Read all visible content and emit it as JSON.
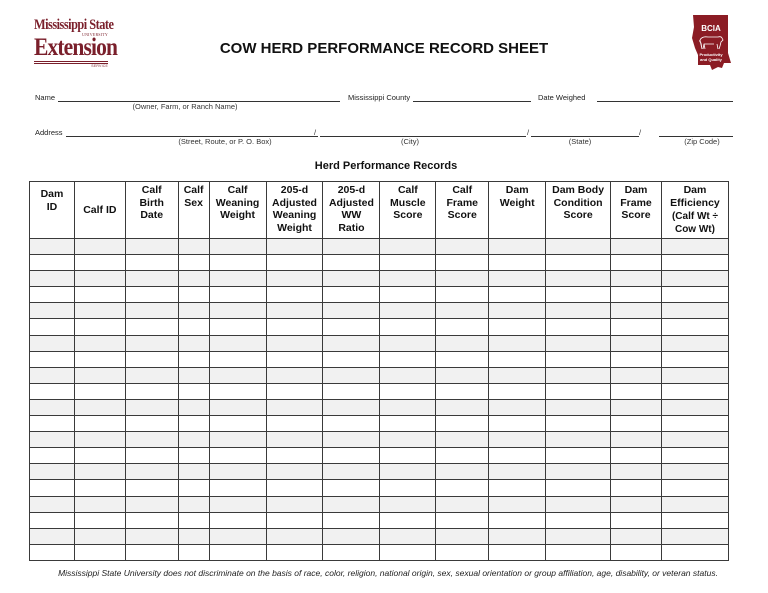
{
  "logos": {
    "left": {
      "line1": "Mississippi State",
      "line2": "UNIVERSITY",
      "line3": "Extension",
      "line4": "SERVICE",
      "brand_color": "#7a1f2b"
    },
    "right": {
      "acronym": "BCIA",
      "tagline1": "Productivity",
      "tagline2": "and Quality",
      "brand_color": "#8b1c24"
    }
  },
  "title": "COW HERD PERFORMANCE RECORD SHEET",
  "form": {
    "name_label": "Name",
    "name_sub": "(Owner, Farm, or Ranch Name)",
    "county_label": "Mississippi County",
    "date_label": "Date Weighed",
    "address_label": "Address",
    "address_subs": [
      "(Street, Route, or P. O. Box)",
      "(City)",
      "(State)",
      "(Zip Code)"
    ],
    "separator": "/"
  },
  "section_title": "Herd Performance Records",
  "table": {
    "columns": [
      [
        "Dam",
        "ID"
      ],
      [
        "Calf ID"
      ],
      [
        "Calf",
        "Birth",
        "Date"
      ],
      [
        "Calf",
        "Sex"
      ],
      [
        "Calf",
        "Weaning",
        "Weight"
      ],
      [
        "205-d",
        "Adjusted",
        "Weaning",
        "Weight"
      ],
      [
        "205-d",
        "Adjusted",
        "WW",
        "Ratio"
      ],
      [
        "Calf",
        "Muscle",
        "Score"
      ],
      [
        "Calf",
        "Frame",
        "Score"
      ],
      [
        "Dam",
        "Weight"
      ],
      [
        "Dam Body",
        "Condition",
        "Score"
      ],
      [
        "Dam",
        "Frame",
        "Score"
      ],
      [
        "Dam",
        "Efficiency",
        "(Calf Wt ÷",
        "Cow Wt)"
      ]
    ],
    "row_count": 20,
    "shade_color": "#f1f1f1"
  },
  "footer": "Mississippi State University does not discriminate on the basis of race, color, religion, national origin, sex, sexual orientation or group affiliation, age, disability, or veteran status."
}
